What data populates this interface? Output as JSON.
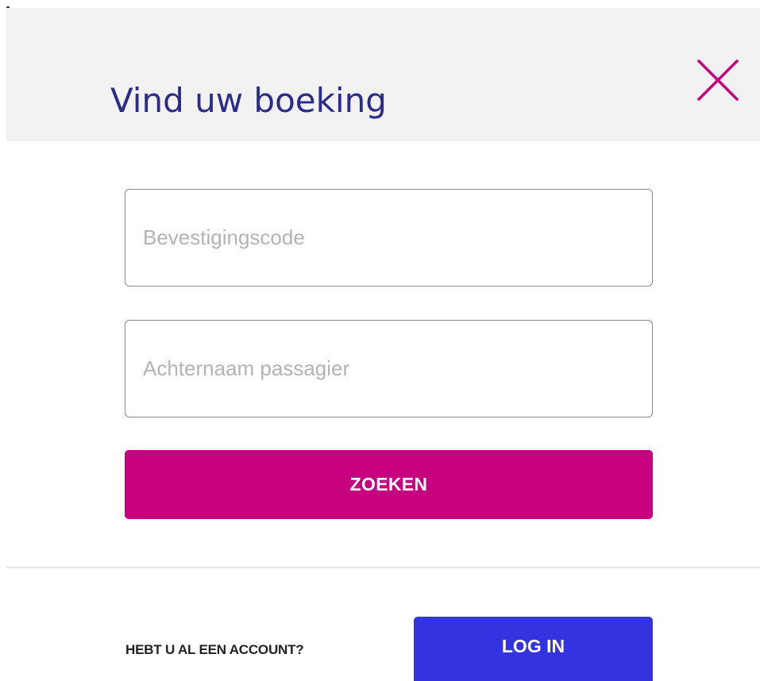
{
  "header": {
    "title": "Vind uw boeking",
    "close_icon": "close-icon"
  },
  "form": {
    "confirmation_code": {
      "value": "",
      "placeholder": "Bevestigingscode"
    },
    "passenger_last_name": {
      "value": "",
      "placeholder": "Achternaam passagier"
    },
    "search_label": "ZOEKEN"
  },
  "account": {
    "question": "HEBT U AL EEN ACCOUNT?",
    "login_label": "LOG IN"
  },
  "colors": {
    "header_bg": "#f2f2f2",
    "title": "#2a2b8c",
    "close_icon": "#c6007e",
    "search_button": "#c6007e",
    "login_button": "#3333e0"
  }
}
